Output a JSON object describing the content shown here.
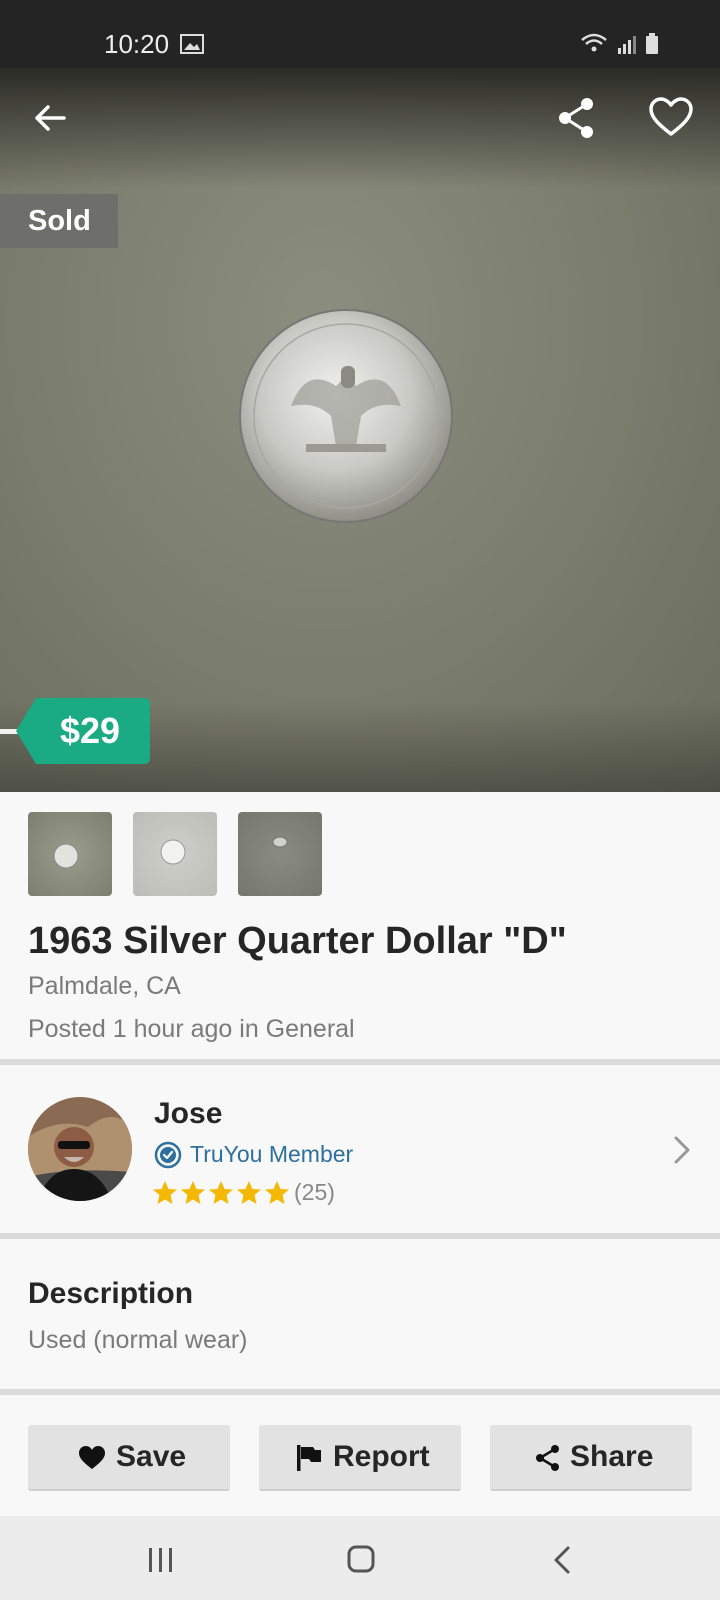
{
  "status_bar": {
    "time": "10:20"
  },
  "listing": {
    "status_badge": "Sold",
    "price": "$29",
    "title": "1963 Silver Quarter Dollar \"D\"",
    "location": "Palmdale, CA",
    "posted": "Posted 1 hour ago in General",
    "thumbnails": [
      {
        "name": "coin-photo-1"
      },
      {
        "name": "coin-photo-2"
      },
      {
        "name": "coin-photo-3"
      }
    ]
  },
  "seller": {
    "name": "Jose",
    "badge": "TruYou Member",
    "rating_stars": 5,
    "rating_count": "(25)"
  },
  "description": {
    "title": "Description",
    "text": "Used (normal wear)"
  },
  "actions": {
    "save": "Save",
    "report": "Report",
    "share": "Share"
  },
  "colors": {
    "price_tag": "#1aab85",
    "truyou_blue": "#2e6f9e",
    "star": "#f5b800",
    "sold_badge": "#6e6f6a"
  },
  "icons": [
    "back-arrow-icon",
    "share-icon",
    "heart-icon",
    "chevron-right-icon",
    "verified-check-icon",
    "star-icon",
    "flag-icon",
    "recent-apps-icon",
    "home-icon",
    "system-back-icon"
  ]
}
